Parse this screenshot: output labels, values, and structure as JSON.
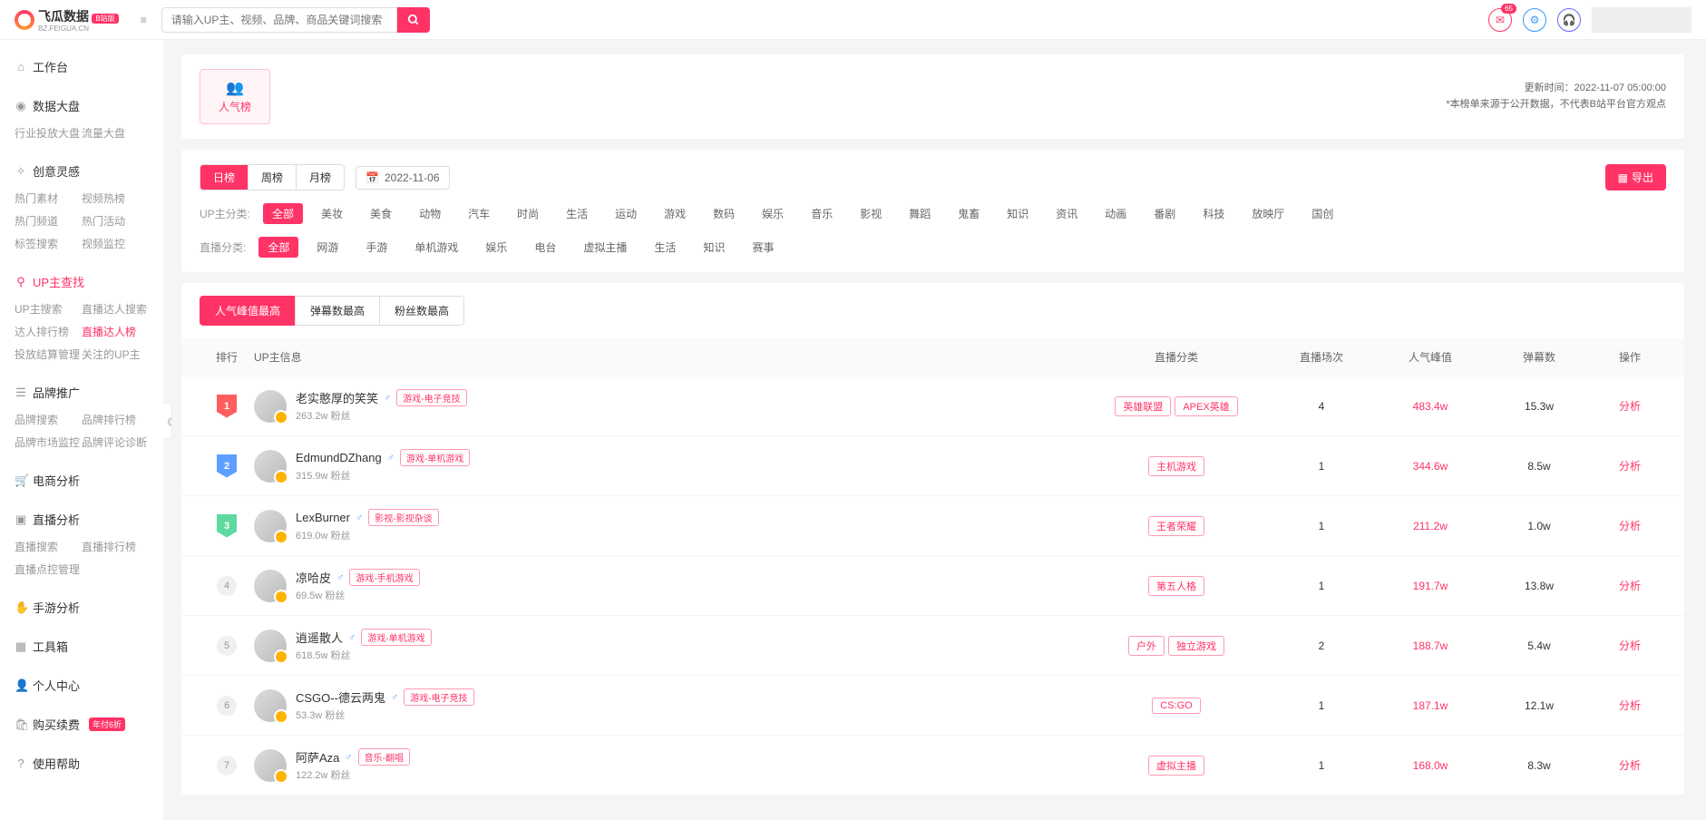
{
  "brand": {
    "name": "飞瓜数据",
    "sub": "BZ.FEIGUA.CN",
    "badge": "B站版"
  },
  "search": {
    "placeholder": "请输入UP主、视频、品牌、商品关键词搜索"
  },
  "notif_count": "65",
  "sidebar": [
    {
      "title": "工作台",
      "icon": "⌂"
    },
    {
      "title": "数据大盘",
      "icon": "◉",
      "sub": [
        {
          "t": "行业投放大盘"
        },
        {
          "t": "流量大盘"
        }
      ]
    },
    {
      "title": "创意灵感",
      "icon": "✧",
      "sub": [
        {
          "t": "热门素材"
        },
        {
          "t": "视频热榜"
        },
        {
          "t": "热门频道"
        },
        {
          "t": "热门活动"
        },
        {
          "t": "标签搜索"
        },
        {
          "t": "视频监控"
        }
      ]
    },
    {
      "title": "UP主查找",
      "icon": "⚲",
      "active": true,
      "sub": [
        {
          "t": "UP主搜索"
        },
        {
          "t": "直播达人搜索"
        },
        {
          "t": "达人排行榜"
        },
        {
          "t": "直播达人榜",
          "active": true
        },
        {
          "t": "投放结算管理"
        },
        {
          "t": "关注的UP主"
        }
      ]
    },
    {
      "title": "品牌推广",
      "icon": "☰",
      "sub": [
        {
          "t": "品牌搜索"
        },
        {
          "t": "品牌排行榜"
        },
        {
          "t": "品牌市场监控"
        },
        {
          "t": "品牌评论诊断"
        }
      ]
    },
    {
      "title": "电商分析",
      "icon": "🛒"
    },
    {
      "title": "直播分析",
      "icon": "▣",
      "sub": [
        {
          "t": "直播搜索"
        },
        {
          "t": "直播排行榜"
        },
        {
          "t": "直播点控管理"
        }
      ]
    },
    {
      "title": "手游分析",
      "icon": "✋"
    },
    {
      "title": "工具箱",
      "icon": "▦"
    },
    {
      "title": "个人中心",
      "icon": "👤"
    },
    {
      "title": "购买续费",
      "icon": "🛍",
      "badge": "年付6折"
    },
    {
      "title": "使用帮助",
      "icon": "?"
    }
  ],
  "rank_tab": "人气榜",
  "meta": {
    "update": "更新时间：2022-11-07 05:00:00",
    "note": "*本榜单来源于公开数据，不代表B站平台官方观点"
  },
  "period_tabs": [
    "日榜",
    "周榜",
    "月榜"
  ],
  "date": "2022-11-06",
  "filters": {
    "up_label": "UP主分类:",
    "up": [
      "全部",
      "美妆",
      "美食",
      "动物",
      "汽车",
      "时尚",
      "生活",
      "运动",
      "游戏",
      "数码",
      "娱乐",
      "音乐",
      "影视",
      "舞蹈",
      "鬼畜",
      "知识",
      "资讯",
      "动画",
      "番剧",
      "科技",
      "放映厅",
      "国创"
    ],
    "live_label": "直播分类:",
    "live": [
      "全部",
      "网游",
      "手游",
      "单机游戏",
      "娱乐",
      "电台",
      "虚拟主播",
      "生活",
      "知识",
      "赛事"
    ]
  },
  "sort_tabs": [
    "人气峰值最高",
    "弹幕数最高",
    "粉丝数最高"
  ],
  "export": "导出",
  "columns": {
    "rank": "排行",
    "up": "UP主信息",
    "cat": "直播分类",
    "cnt": "直播场次",
    "peak": "人气峰值",
    "dm": "弹幕数",
    "op": "操作"
  },
  "fans_suffix": "粉丝",
  "analyze": "分析",
  "rows": [
    {
      "rank": 1,
      "name": "老实憨厚的笑笑",
      "gender": "♂",
      "tag": "游戏-电子竞技",
      "fans": "263.2w",
      "cat": [
        "英雄联盟",
        "APEX英雄"
      ],
      "cnt": "4",
      "peak": "483.4w",
      "dm": "15.3w"
    },
    {
      "rank": 2,
      "name": "EdmundDZhang",
      "gender": "♂",
      "tag": "游戏-单机游戏",
      "fans": "315.9w",
      "cat": [
        "主机游戏"
      ],
      "cnt": "1",
      "peak": "344.6w",
      "dm": "8.5w"
    },
    {
      "rank": 3,
      "name": "LexBurner",
      "gender": "♂",
      "tag": "影视-影视杂谈",
      "fans": "619.0w",
      "cat": [
        "王者荣耀"
      ],
      "cnt": "1",
      "peak": "211.2w",
      "dm": "1.0w"
    },
    {
      "rank": 4,
      "name": "凉哈皮",
      "gender": "♂",
      "tag": "游戏-手机游戏",
      "fans": "69.5w",
      "cat": [
        "第五人格"
      ],
      "cnt": "1",
      "peak": "191.7w",
      "dm": "13.8w"
    },
    {
      "rank": 5,
      "name": "逍遥散人",
      "gender": "♂",
      "tag": "游戏-单机游戏",
      "fans": "618.5w",
      "cat": [
        "户外",
        "独立游戏"
      ],
      "cnt": "2",
      "peak": "188.7w",
      "dm": "5.4w"
    },
    {
      "rank": 6,
      "name": "CSGO--德云两鬼",
      "gender": "♂",
      "tag": "游戏-电子竞技",
      "fans": "53.3w",
      "cat": [
        "CS:GO"
      ],
      "cnt": "1",
      "peak": "187.1w",
      "dm": "12.1w"
    },
    {
      "rank": 7,
      "name": "阿萨Aza",
      "gender": "♂",
      "tag": "音乐-翻唱",
      "fans": "122.2w",
      "cat": [
        "虚拟主播"
      ],
      "cnt": "1",
      "peak": "168.0w",
      "dm": "8.3w"
    }
  ]
}
